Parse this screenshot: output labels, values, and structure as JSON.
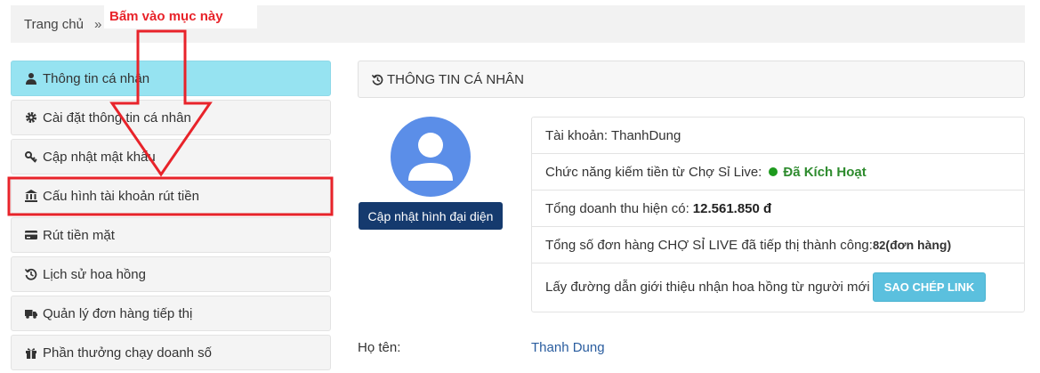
{
  "breadcrumb": {
    "home": "Trang chủ",
    "separator": "»"
  },
  "annotation": {
    "text": "Bấm vào mục này",
    "color": "#e8232a"
  },
  "sidebar": {
    "items": [
      {
        "label": "Thông tin cá nhân",
        "icon": "user-icon",
        "active": true
      },
      {
        "label": "Cài đặt thông tin cá nhân",
        "icon": "gear-icon"
      },
      {
        "label": "Cập nhật mật khẩu",
        "icon": "key-icon"
      },
      {
        "label": "Cấu hình tài khoản rút tiền",
        "icon": "bank-icon"
      },
      {
        "label": "Rút tiền mặt",
        "icon": "credit-card-icon"
      },
      {
        "label": "Lịch sử hoa hồng",
        "icon": "history-icon"
      },
      {
        "label": "Quản lý đơn hàng tiếp thị",
        "icon": "truck-icon"
      },
      {
        "label": "Phần thưởng chạy doanh số",
        "icon": "gift-icon"
      }
    ]
  },
  "panel": {
    "title": "THÔNG TIN CÁ NHÂN",
    "avatar_button": "Cập nhật hình đại diện",
    "account": "Tài khoản: ThanhDung",
    "feature_label": "Chức năng kiếm tiền từ Chợ Sỉ Live:",
    "feature_status": "Đã Kích Hoạt",
    "revenue_label": "Tổng doanh thu hiện có:",
    "revenue_value": "12.561.850 đ",
    "orders_label": "Tổng số đơn hàng CHỢ SỈ LIVE đã tiếp thị thành công:",
    "orders_count": "82",
    "orders_unit": "(đơn hàng)",
    "link_label": "Lấy đường dẫn giới thiệu nhận hoa hồng từ người mới",
    "copy_button": "SAO CHÉP LINK",
    "name_label": "Họ tên:",
    "name_value": "Thanh Dung"
  },
  "colors": {
    "active_item": "#96e3f1",
    "avatar_button": "#153a6e",
    "copy_button": "#5bc0de",
    "status": "#2e8b2e",
    "highlight": "#e8232a"
  }
}
